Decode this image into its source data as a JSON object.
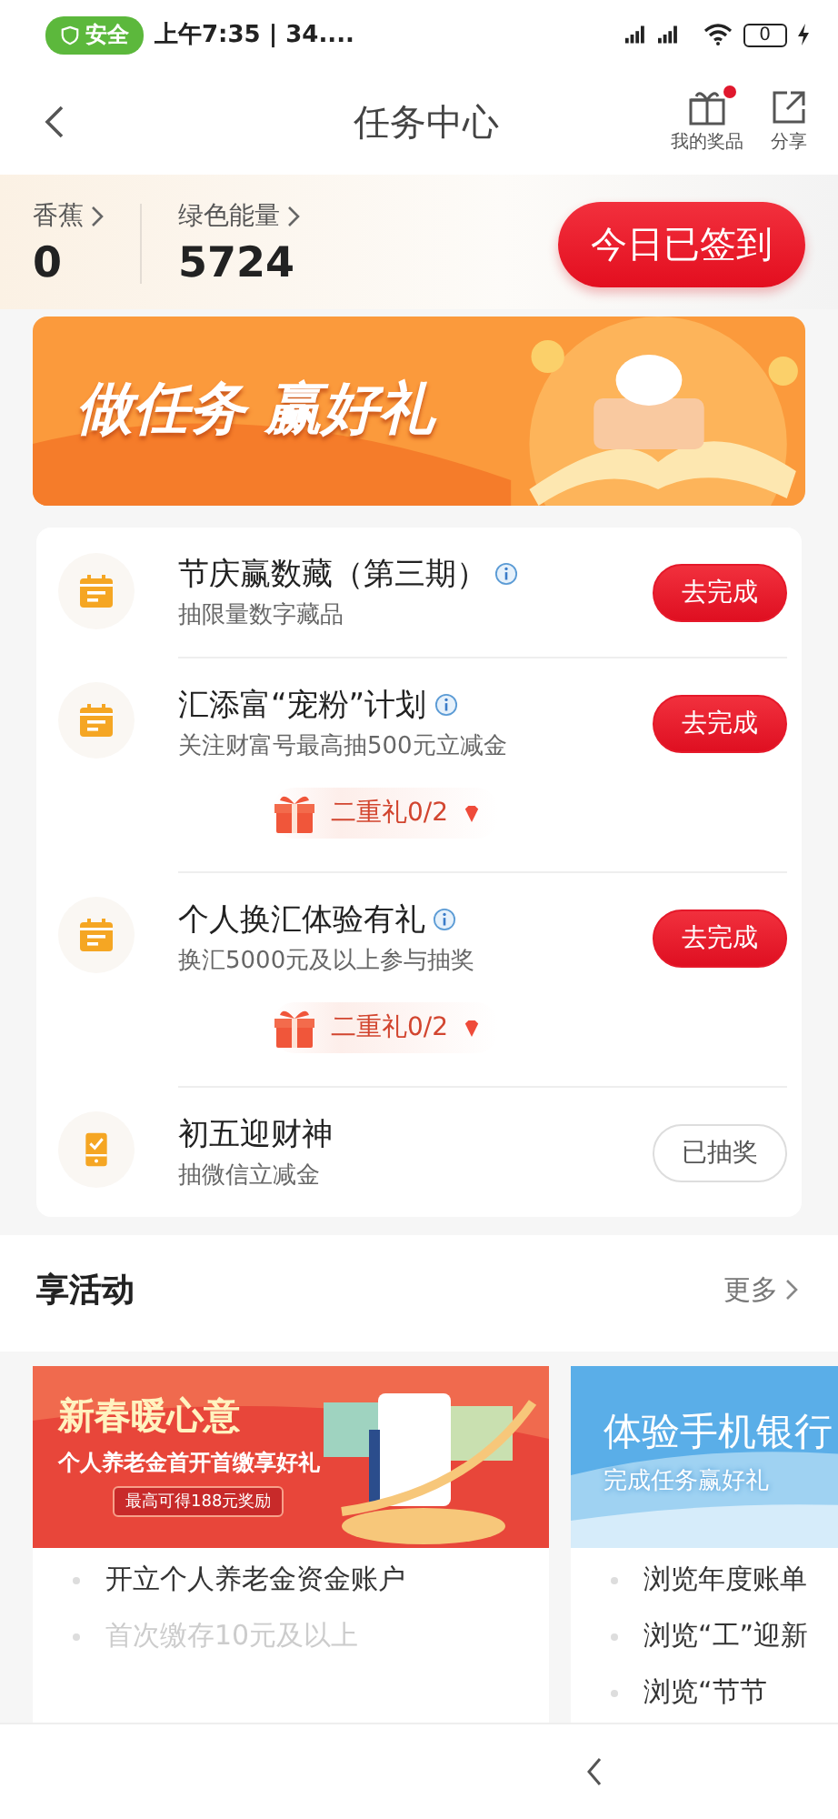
{
  "status_bar": {
    "badge": "安全",
    "time": "上午7:35 | 34....",
    "battery": "0"
  },
  "header": {
    "title": "任务中心",
    "actions": [
      {
        "label": "我的奖品",
        "kind": "gift",
        "dot": true
      },
      {
        "label": "分享",
        "kind": "share",
        "dot": false
      }
    ]
  },
  "stats": [
    {
      "label": "香蕉",
      "value": "0"
    },
    {
      "label": "绿色能量",
      "value": "5724"
    }
  ],
  "checkin_button": "今日已签到",
  "banner": {
    "title": "做任务 赢好礼"
  },
  "tasks": [
    {
      "kind": "calendar",
      "title": "节庆赢数藏（第三期）",
      "info": true,
      "subtitle": "抽限量数字藏品",
      "button": "去完成",
      "completed": false
    },
    {
      "kind": "calendar",
      "title": "汇添富“宠粉”计划",
      "info": true,
      "subtitle": "关注财富号最高抽500元立减金",
      "bonus": "二重礼0/2",
      "button": "去完成",
      "completed": false
    },
    {
      "kind": "calendar",
      "title": "个人换汇体验有礼",
      "info": true,
      "subtitle": "换汇5000元及以上参与抽奖",
      "bonus": "二重礼0/2",
      "button": "去完成",
      "completed": false
    },
    {
      "kind": "phone",
      "title": "初五迎财神",
      "info": false,
      "subtitle": "抽微信立减金",
      "button": "已抽奖",
      "completed": true
    }
  ],
  "activities": {
    "title": "享活动",
    "more": "更多",
    "cards": [
      {
        "kind": "red",
        "headline": "新春暖心意",
        "tagline": "个人养老金首开首缴享好礼",
        "tag": "最高可得188元奖励",
        "items": [
          {
            "text": "开立个人养老金资金账户",
            "faded": false
          },
          {
            "text": "首次缴存10元及以上",
            "faded": true
          }
        ]
      },
      {
        "kind": "blue",
        "headline": "体验手机银行",
        "tagline": "完成任务赢好礼",
        "items": [
          {
            "text": "浏览年度账单",
            "faded": false
          },
          {
            "text": "浏览“工”迎新",
            "faded": false
          },
          {
            "text": "浏览“节节",
            "faded": false
          }
        ]
      }
    ]
  }
}
